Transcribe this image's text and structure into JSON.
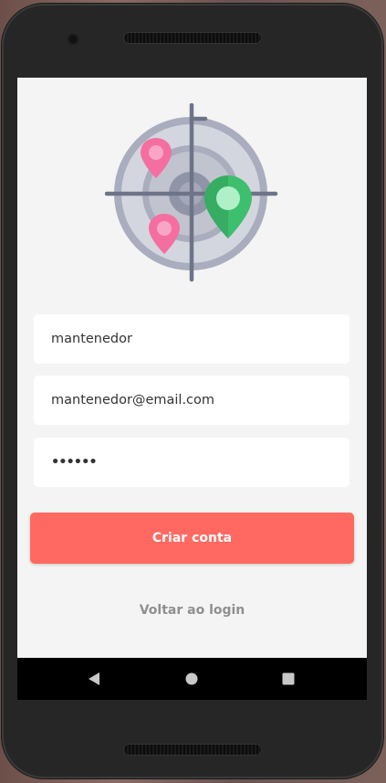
{
  "app": {
    "name_field": {
      "value": "mantenedor"
    },
    "email_field": {
      "value": "mantenedor@email.com"
    },
    "password_field": {
      "value": "••••••"
    },
    "create_button_label": "Criar conta",
    "back_to_login_label": "Voltar ao login"
  },
  "logo": {
    "icon": "location-radar-logo",
    "colors": {
      "pin_pink": "#f46fa0",
      "pin_green": "#3dbf6e",
      "radar_gray": "#a9adbd"
    }
  },
  "navigation_bar": {
    "back_icon": "back-triangle-icon",
    "home_icon": "home-circle-icon",
    "recents_icon": "recents-square-icon"
  },
  "theme": {
    "accent": "#ff6961",
    "background": "#f4f4f4"
  }
}
